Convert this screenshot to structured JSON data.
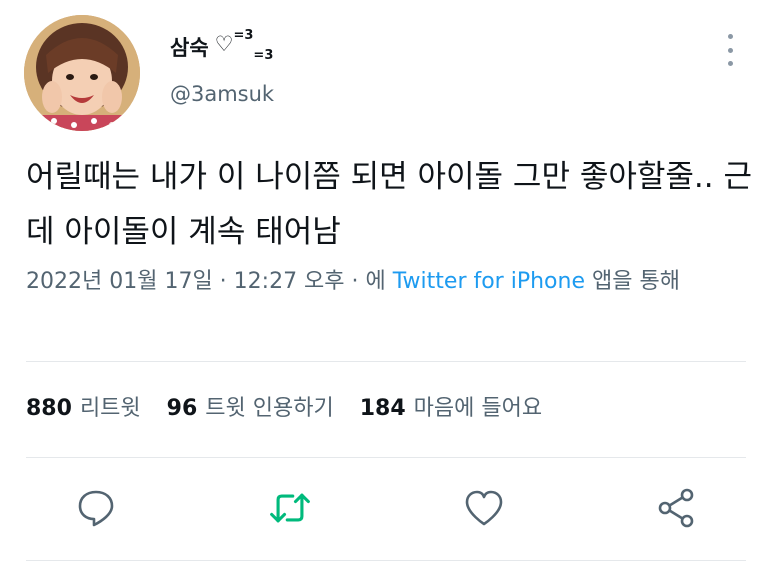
{
  "user": {
    "display_name": "삼숙",
    "name_heart": "♡",
    "name_sup": "=3",
    "name_sub": "=3",
    "handle": "@3amsuk"
  },
  "tweet": {
    "text": "어릴때는 내가 이 나이쯤 되면 아이돌 그만 좋아할줄.. 근데 아이돌이 계속 태어남",
    "meta_prefix": "2022년 01월 17일 · 12:27 오후 · 에 ",
    "source": "Twitter for iPhone",
    "meta_suffix": " 앱을 통해"
  },
  "stats": {
    "retweets_count": "880",
    "retweets_label": "리트윗",
    "quotes_count": "96",
    "quotes_label": "트윗 인용하기",
    "likes_count": "184",
    "likes_label": "마음에 들어요"
  },
  "colors": {
    "text_primary": "#0f1419",
    "text_secondary": "#536471",
    "link": "#1d9bf0",
    "retweet_active": "#00ba7c",
    "icon_gray": "#536471"
  },
  "icons": {
    "more": "more-vertical-icon",
    "reply": "reply-icon",
    "retweet": "retweet-icon",
    "like": "heart-icon",
    "share": "share-icon"
  }
}
